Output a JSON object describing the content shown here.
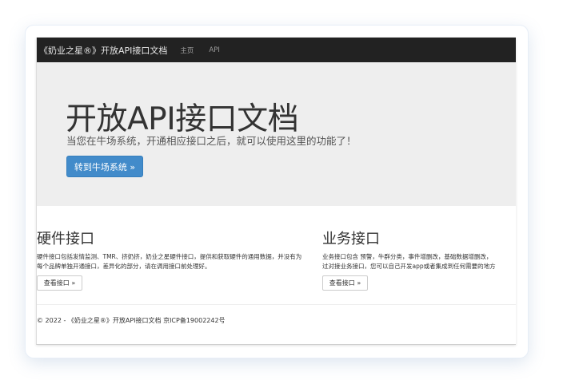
{
  "navbar": {
    "brand": "《奶业之星®》开放API接口文档",
    "links": [
      "主页",
      "API"
    ]
  },
  "jumbotron": {
    "title": "开放API接口文档",
    "lead": "当您在牛场系统，开通相应接口之后，就可以使用这里的功能了！",
    "button_label": "转到牛场系统 »"
  },
  "sections": [
    {
      "heading": "硬件接口",
      "text": "硬件接口包括发情监测、TMR、挤奶挤，奶业之星硬件接口，提供和获取硬件的通用数据，并没有为每个品牌单独开通接口，差异化的部分，请在调用接口前处理好。",
      "button_label": "查看接口 »"
    },
    {
      "heading": "业务接口",
      "text_line1": "业务接口包含 预警，牛群分类，事件增删改，基础数据增删改，",
      "text_line2": "过对接业务接口，您可以自己开发app或者集成到任何需要的地方",
      "button_label": "查看接口 »"
    }
  ],
  "footer": {
    "text": "© 2022 - 《奶业之星®》开放API接口文档  京ICP备19002242号"
  },
  "colors": {
    "navbar_bg": "#222222",
    "jumbotron_bg": "#eeeeee",
    "primary": "#428bca"
  }
}
